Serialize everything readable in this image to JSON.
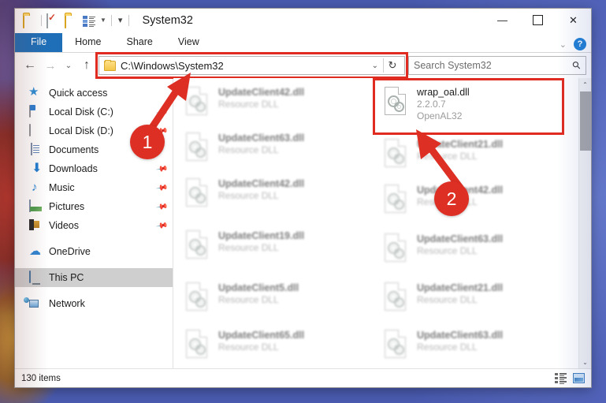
{
  "window": {
    "title": "System32",
    "quick_access": [
      "folder-icon",
      "properties-icon",
      "new-folder-icon",
      "customize-icon",
      "more-icon"
    ],
    "controls": {
      "minimize": "—",
      "maximize": "❐",
      "close": "✕",
      "ribbon_expand": "⌄",
      "help": "?"
    }
  },
  "ribbon": {
    "tabs": [
      {
        "label": "File",
        "active": true
      },
      {
        "label": "Home",
        "active": false
      },
      {
        "label": "Share",
        "active": false
      },
      {
        "label": "View",
        "active": false
      }
    ]
  },
  "address": {
    "back": "←",
    "forward": "→",
    "recent": "⌄",
    "up": "↑",
    "path": "C:\\Windows\\System32",
    "dropdown": "⌄",
    "refresh": "↻",
    "highlighted": true,
    "highlight_color": "#e02b20"
  },
  "search": {
    "placeholder": "Search System32",
    "icon": "search-icon"
  },
  "sidebar": {
    "items": [
      {
        "label": "Quick access",
        "icon": "star-icon",
        "pinned": false,
        "selected": false
      },
      {
        "label": "Local Disk (C:)",
        "icon": "drive-icon",
        "pinned": true,
        "selected": false
      },
      {
        "label": "Local Disk (D:)",
        "icon": "drive-icon",
        "pinned": true,
        "selected": false
      },
      {
        "label": "Documents",
        "icon": "document-icon",
        "pinned": false,
        "selected": false
      },
      {
        "label": "Downloads",
        "icon": "download-icon",
        "pinned": true,
        "selected": false
      },
      {
        "label": "Music",
        "icon": "music-icon",
        "pinned": true,
        "selected": false
      },
      {
        "label": "Pictures",
        "icon": "picture-icon",
        "pinned": true,
        "selected": false
      },
      {
        "label": "Videos",
        "icon": "video-icon",
        "pinned": true,
        "selected": false
      },
      {
        "label": "OneDrive",
        "icon": "cloud-icon",
        "pinned": false,
        "selected": false
      },
      {
        "label": "This PC",
        "icon": "pc-icon",
        "pinned": false,
        "selected": true
      },
      {
        "label": "Network",
        "icon": "network-icon",
        "pinned": false,
        "selected": false
      }
    ]
  },
  "files": {
    "column_left": [
      {
        "name": "UpdateClient42.dll",
        "sub": "Resource DLL",
        "blurred": true
      },
      {
        "name": "UpdateClient63.dll",
        "sub": "Resource DLL",
        "blurred": true
      },
      {
        "name": "UpdateClient42.dll",
        "sub": "Resource DLL",
        "blurred": true
      },
      {
        "name": "UpdateClient19.dll",
        "sub": "Resource DLL",
        "blurred": true
      },
      {
        "name": "UpdateClient5.dll",
        "sub": "Resource DLL",
        "blurred": true
      },
      {
        "name": "UpdateClient65.dll",
        "sub": "Resource DLL",
        "blurred": true
      }
    ],
    "column_right": [
      {
        "name": "wrap_oal.dll",
        "sub": "2.2.0.7",
        "sub2": "OpenAL32",
        "blurred": false,
        "highlighted": true
      },
      {
        "name": "UpdateClient21.dll",
        "sub": "Resource DLL",
        "blurred": true
      },
      {
        "name": "UpdateClient42.dll",
        "sub": "Resource DLL",
        "blurred": true
      },
      {
        "name": "UpdateClient63.dll",
        "sub": "Resource DLL",
        "blurred": true
      },
      {
        "name": "UpdateClient21.dll",
        "sub": "Resource DLL",
        "blurred": true
      },
      {
        "name": "UpdateClient63.dll",
        "sub": "Resource DLL",
        "blurred": true
      }
    ]
  },
  "status": {
    "item_count": "130 items",
    "view_details": "details-view-icon",
    "view_large": "large-icons-view-icon"
  },
  "annotations": {
    "markers": [
      {
        "number": "1",
        "points_to": "address-bar"
      },
      {
        "number": "2",
        "points_to": "wrap-oal-file"
      }
    ],
    "color": "#dd2f24"
  },
  "scrollbar": {
    "up": "⌃",
    "down": "⌄"
  }
}
